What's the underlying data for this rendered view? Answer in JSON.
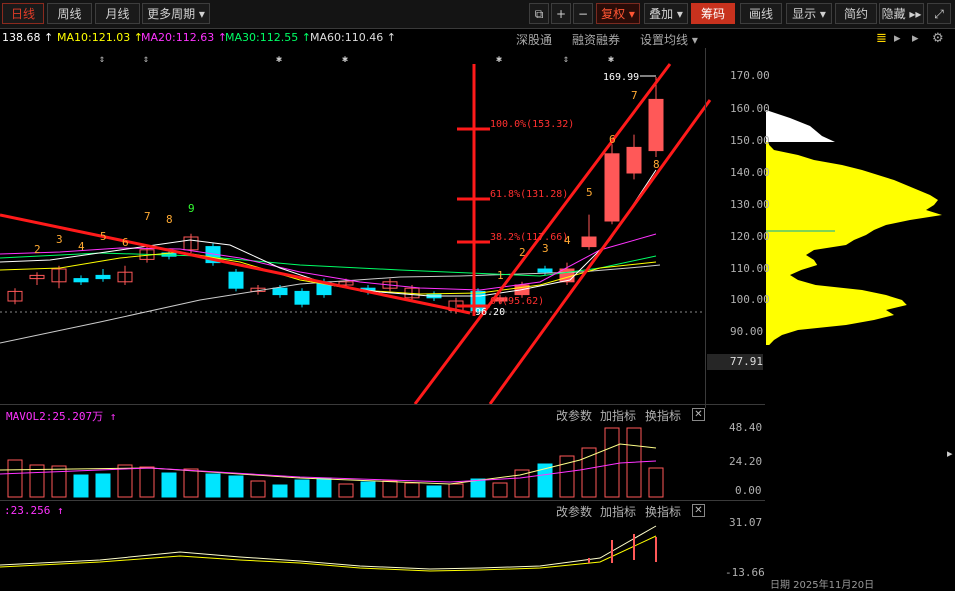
{
  "toolbar": {
    "periods": [
      "日线",
      "周线",
      "月线",
      "更多周期 ▾"
    ],
    "icons": [
      "⧉",
      "+",
      "−"
    ],
    "fuquan": "复权 ▾",
    "diejia": "叠加 ▾",
    "chouma": "筹码",
    "huaxian": "画线",
    "xianshi": "显示 ▾",
    "jianyue": "简约",
    "yincang": "隐藏 ▸▸",
    "fullscreen": "⤢"
  },
  "ma_bar": {
    "ma5": "138.68 ↑",
    "ma10": "MA10:121.03 ↑",
    "ma20": "MA20:112.63 ↑",
    "ma30": "MA30:112.55 ↑",
    "ma60": "MA60:110.46 ↑",
    "links": [
      "深股通",
      "融资融券",
      "设置均线 ▾"
    ]
  },
  "colors": {
    "up": "#ff5858",
    "down": "#00e5ff",
    "ma5": "#ffffff",
    "ma10": "#ffff00",
    "ma20": "#ff33ff",
    "ma30": "#00ff66",
    "ma60": "#cccccc",
    "trend": "#ff1a1a"
  },
  "price_axis": {
    "ticks": [
      "170.00",
      "160.00",
      "150.00",
      "140.00",
      "130.00",
      "120.00",
      "110.00",
      "100.00",
      "90.00"
    ],
    "current": "77.91"
  },
  "annotations": {
    "high_label": "169.99",
    "low_label": "96.20",
    "fib": [
      "100.0%(153.32)",
      "61.8%(131.28)",
      "38.2%(117.66)",
      "0%(95.62)"
    ],
    "nine_up": [
      "1",
      "2",
      "3",
      "4",
      "5",
      "6",
      "7",
      "8"
    ],
    "nine_down": [
      "2",
      "3",
      "4",
      "5",
      "6",
      "7",
      "8",
      "9"
    ]
  },
  "vol_panel": {
    "label": "MAVOL2:25.207万 ↑",
    "actions": [
      "改参数",
      "加指标",
      "换指标"
    ],
    "ticks": [
      "48.40",
      "24.20",
      "0.00"
    ]
  },
  "ind_panel": {
    "label": ":23.256 ↑",
    "actions": [
      "改参数",
      "加指标",
      "换指标"
    ],
    "ticks": [
      "31.07",
      "-13.66"
    ]
  },
  "footer": {
    "date_partial": "日期  2025年11月20日"
  }
}
